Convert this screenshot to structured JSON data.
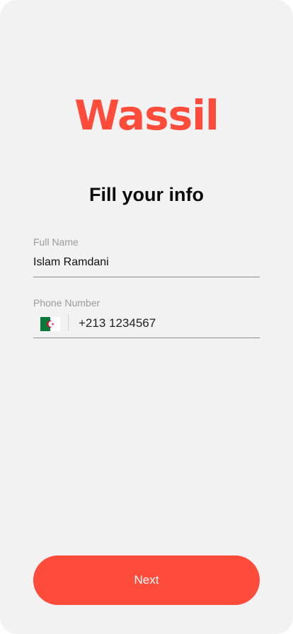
{
  "brand": {
    "logo_text": "Wassil",
    "accent_color": "#ff4b3a"
  },
  "page": {
    "title": "Fill your info"
  },
  "form": {
    "full_name": {
      "label": "Full Name",
      "value": "Islam Ramdani"
    },
    "phone": {
      "label": "Phone Number",
      "country_flag": "algeria-flag-icon",
      "value": "+213 1234567"
    }
  },
  "actions": {
    "next_label": "Next"
  }
}
